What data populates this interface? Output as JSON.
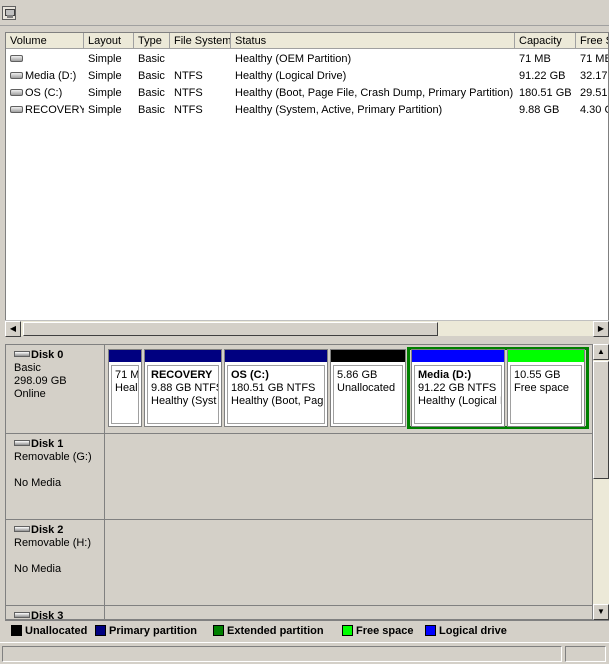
{
  "columns": [
    "Volume",
    "Layout",
    "Type",
    "File System",
    "Status",
    "Capacity",
    "Free S"
  ],
  "volumes": [
    {
      "volume": "",
      "layout": "Simple",
      "type": "Basic",
      "fs": "",
      "status": "Healthy (OEM Partition)",
      "capacity": "71 MB",
      "free": "71 MB"
    },
    {
      "volume": "Media (D:)",
      "layout": "Simple",
      "type": "Basic",
      "fs": "NTFS",
      "status": "Healthy (Logical Drive)",
      "capacity": "91.22 GB",
      "free": "32.17"
    },
    {
      "volume": "OS (C:)",
      "layout": "Simple",
      "type": "Basic",
      "fs": "NTFS",
      "status": "Healthy (Boot, Page File, Crash Dump, Primary Partition)",
      "capacity": "180.51 GB",
      "free": "29.51"
    },
    {
      "volume": "RECOVERY",
      "layout": "Simple",
      "type": "Basic",
      "fs": "NTFS",
      "status": "Healthy (System, Active, Primary Partition)",
      "capacity": "9.88 GB",
      "free": "4.30 G"
    }
  ],
  "disks": [
    {
      "name": "Disk 0",
      "kind": "Basic",
      "size": "298.09 GB",
      "state": "Online",
      "partitions": [
        {
          "title": "",
          "line1": "71 M",
          "line2": "Heal",
          "color": "#000080"
        },
        {
          "title": "RECOVERY",
          "line1": "9.88 GB NTFS",
          "line2": "Healthy (Syst",
          "color": "#000080"
        },
        {
          "title": "OS  (C:)",
          "line1": "180.51 GB NTFS",
          "line2": "Healthy (Boot, Pag",
          "color": "#000080"
        },
        {
          "title": "",
          "line1": "5.86 GB",
          "line2": "Unallocated",
          "color": "#000000"
        },
        {
          "title": "Media  (D:)",
          "line1": "91.22 GB NTFS",
          "line2": "Healthy (Logical I",
          "color": "#0000ff"
        },
        {
          "title": "",
          "line1": "10.55 GB",
          "line2": "Free space",
          "color": "#00ff00"
        }
      ]
    },
    {
      "name": "Disk 1",
      "kind": "Removable (G:)",
      "state": "No Media"
    },
    {
      "name": "Disk 2",
      "kind": "Removable (H:)",
      "state": "No Media"
    },
    {
      "name": "Disk 3"
    }
  ],
  "legend": [
    {
      "label": "Unallocated",
      "color": "#000000"
    },
    {
      "label": "Primary partition",
      "color": "#000080"
    },
    {
      "label": "Extended partition",
      "color": "#008000"
    },
    {
      "label": "Free space",
      "color": "#00ff00"
    },
    {
      "label": "Logical drive",
      "color": "#0000ff"
    }
  ]
}
